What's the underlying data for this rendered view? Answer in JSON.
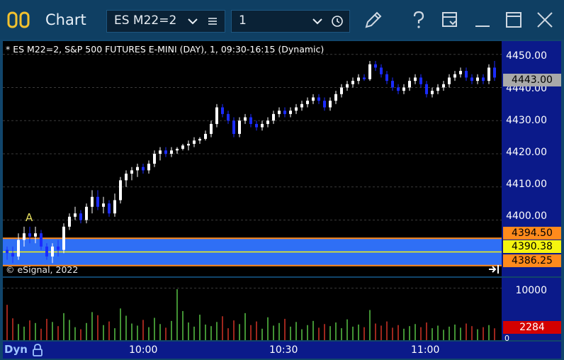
{
  "window": {
    "title": "Chart",
    "symbol": "ES M22=2",
    "interval": "1"
  },
  "chart": {
    "header": "* ES M22=2, S&P 500 FUTURES E-MINI (DAY), 1, 09:30-16:15 (Dynamic)",
    "copyright": "© eSignal, 2022",
    "marker_label": "A",
    "price_ticks": [
      "4450.00",
      "4440.00",
      "4430.00",
      "4420.00",
      "4410.00",
      "4400.00"
    ],
    "last_price": "4443.00",
    "band_upper": "4394.50",
    "band_mid": "4390.38",
    "band_lower": "4386.25",
    "volume_tick": "10000",
    "volume_last": "2284",
    "volume_zero": "0",
    "time_ticks": [
      "10:00",
      "10:30",
      "11:00"
    ],
    "status_label": "Dyn"
  },
  "colors": {
    "up_candle": "#ffffff",
    "down_candle": "#1b2cff",
    "band_fill": "#2f6ff5",
    "band_border": "#ff8a1c",
    "last_price_bg": "#a9a9a9",
    "mid_bg": "#f5f50f",
    "volume_up": "#5fd24a",
    "volume_down": "#e2362a"
  },
  "chart_data": {
    "type": "bar",
    "ylim": [
      4383,
      4454
    ],
    "candles": [
      [
        4391,
        4392,
        4388,
        4390
      ],
      [
        4390,
        4392,
        4387,
        4389
      ],
      [
        4389,
        4396,
        4388,
        4394
      ],
      [
        4394,
        4398,
        4392,
        4396
      ],
      [
        4396,
        4398,
        4393,
        4395
      ],
      [
        4395,
        4398,
        4393,
        4396
      ],
      [
        4396,
        4397,
        4391,
        4392
      ],
      [
        4392,
        4393,
        4388,
        4389
      ],
      [
        4389,
        4393,
        4387,
        4392
      ],
      [
        4392,
        4394,
        4389,
        4391
      ],
      [
        4391,
        4399,
        4390,
        4398
      ],
      [
        4398,
        4402,
        4397,
        4401
      ],
      [
        4401,
        4404,
        4400,
        4402
      ],
      [
        4402,
        4403,
        4399,
        4400
      ],
      [
        4400,
        4405,
        4399,
        4404
      ],
      [
        4404,
        4409,
        4402,
        4407
      ],
      [
        4407,
        4409,
        4403,
        4404
      ],
      [
        4404,
        4407,
        4402,
        4405
      ],
      [
        4405,
        4406,
        4401,
        4402
      ],
      [
        4402,
        4408,
        4401,
        4406
      ],
      [
        4406,
        4413,
        4405,
        4412
      ],
      [
        4412,
        4415,
        4410,
        4414
      ],
      [
        4414,
        4416,
        4412,
        4415
      ],
      [
        4415,
        4417,
        4413,
        4416
      ],
      [
        4416,
        4417,
        4414,
        4415
      ],
      [
        4415,
        4418,
        4414,
        4417
      ],
      [
        4417,
        4421,
        4416,
        4420
      ],
      [
        4420,
        4422,
        4418,
        4421
      ],
      [
        4421,
        4422,
        4419,
        4420
      ],
      [
        4420,
        4422,
        4419,
        4421
      ],
      [
        4421,
        4422,
        4420,
        4421.5
      ],
      [
        4421.5,
        4423,
        4421,
        4422.5
      ],
      [
        4422.5,
        4424,
        4421,
        4423
      ],
      [
        4423,
        4425,
        4422,
        4424
      ],
      [
        4424,
        4425,
        4423,
        4424.5
      ],
      [
        4424.5,
        4427,
        4424,
        4426
      ],
      [
        4426,
        4430,
        4425,
        4429
      ],
      [
        4429,
        4435,
        4428,
        4434
      ],
      [
        4434,
        4435,
        4431,
        4432
      ],
      [
        4432,
        4433,
        4429,
        4430
      ],
      [
        4430,
        4431,
        4425,
        4426
      ],
      [
        4426,
        4431,
        4425,
        4430
      ],
      [
        4430,
        4432,
        4429,
        4431
      ],
      [
        4431,
        4432,
        4428,
        4429
      ],
      [
        4429,
        4430,
        4427,
        4428
      ],
      [
        4428,
        4430,
        4427,
        4429
      ],
      [
        4429,
        4431,
        4428,
        4430
      ],
      [
        4430,
        4433,
        4429,
        4432
      ],
      [
        4432,
        4434,
        4431,
        4433
      ],
      [
        4433,
        4434,
        4431,
        4432
      ],
      [
        4432,
        4434,
        4431,
        4433
      ],
      [
        4433,
        4435,
        4432,
        4434
      ],
      [
        4434,
        4436,
        4433,
        4435
      ],
      [
        4435,
        4437,
        4434,
        4436
      ],
      [
        4436,
        4438,
        4435,
        4437
      ],
      [
        4437,
        4438,
        4435,
        4436
      ],
      [
        4436,
        4437,
        4433,
        4434
      ],
      [
        4434,
        4437,
        4433,
        4436
      ],
      [
        4436,
        4439,
        4435,
        4438
      ],
      [
        4438,
        4441,
        4437,
        4440
      ],
      [
        4440,
        4442,
        4439,
        4441
      ],
      [
        4441,
        4443,
        4440,
        4442
      ],
      [
        4442,
        4444,
        4441,
        4443
      ],
      [
        4443,
        4444,
        4442,
        4442.5
      ],
      [
        4442.5,
        4448,
        4442,
        4447
      ],
      [
        4447,
        4448,
        4445,
        4446
      ],
      [
        4446,
        4447,
        4443,
        4444
      ],
      [
        4444,
        4445,
        4441,
        4442
      ],
      [
        4442,
        4443,
        4439,
        4440
      ],
      [
        4440,
        4441,
        4438,
        4439
      ],
      [
        4439,
        4441,
        4438,
        4440
      ],
      [
        4440,
        4443,
        4439,
        4442
      ],
      [
        4442,
        4444,
        4441,
        4443
      ],
      [
        4443,
        4444,
        4440,
        4441
      ],
      [
        4441,
        4442,
        4437,
        4438
      ],
      [
        4438,
        4440,
        4437,
        4439
      ],
      [
        4439,
        4441,
        4438,
        4440
      ],
      [
        4440,
        4442,
        4439,
        4441
      ],
      [
        4441,
        4444,
        4440,
        4443
      ],
      [
        4443,
        4445,
        4442,
        4444
      ],
      [
        4444,
        4446,
        4443,
        4445
      ],
      [
        4445,
        4446,
        4442,
        4443
      ],
      [
        4443,
        4444,
        4441,
        4442
      ],
      [
        4442,
        4444,
        4441,
        4443
      ],
      [
        4443,
        4444,
        4441,
        4442
      ],
      [
        4442,
        4447,
        4441,
        4446
      ],
      [
        4446,
        4448,
        4442,
        4443
      ]
    ],
    "volumes": [
      6800,
      4200,
      3100,
      2600,
      3800,
      3300,
      2200,
      4100,
      3500,
      2700,
      5200,
      3900,
      2500,
      2100,
      3300,
      5400,
      4800,
      2900,
      3600,
      2300,
      6100,
      4700,
      3200,
      2800,
      3900,
      2500,
      4300,
      3100,
      2400,
      3700,
      9800,
      5600,
      3400,
      2600,
      4900,
      3000,
      2700,
      3500,
      4600,
      2300,
      3800,
      3100,
      5200,
      2900,
      3600,
      2200,
      4400,
      2800,
      3300,
      4100,
      2600,
      3500,
      2100,
      2900,
      3700,
      2400,
      3100,
      2700,
      3400,
      2300,
      4000,
      2600,
      3000,
      2500,
      5800,
      3200,
      2800,
      3600,
      2400,
      2900,
      2200,
      2700,
      3100,
      2500,
      3400,
      2300,
      2800,
      2000,
      2600,
      3000,
      2400,
      3200,
      2700,
      2100,
      2500,
      2900,
      2284
    ],
    "volume_ylim": [
      0,
      12000
    ]
  }
}
